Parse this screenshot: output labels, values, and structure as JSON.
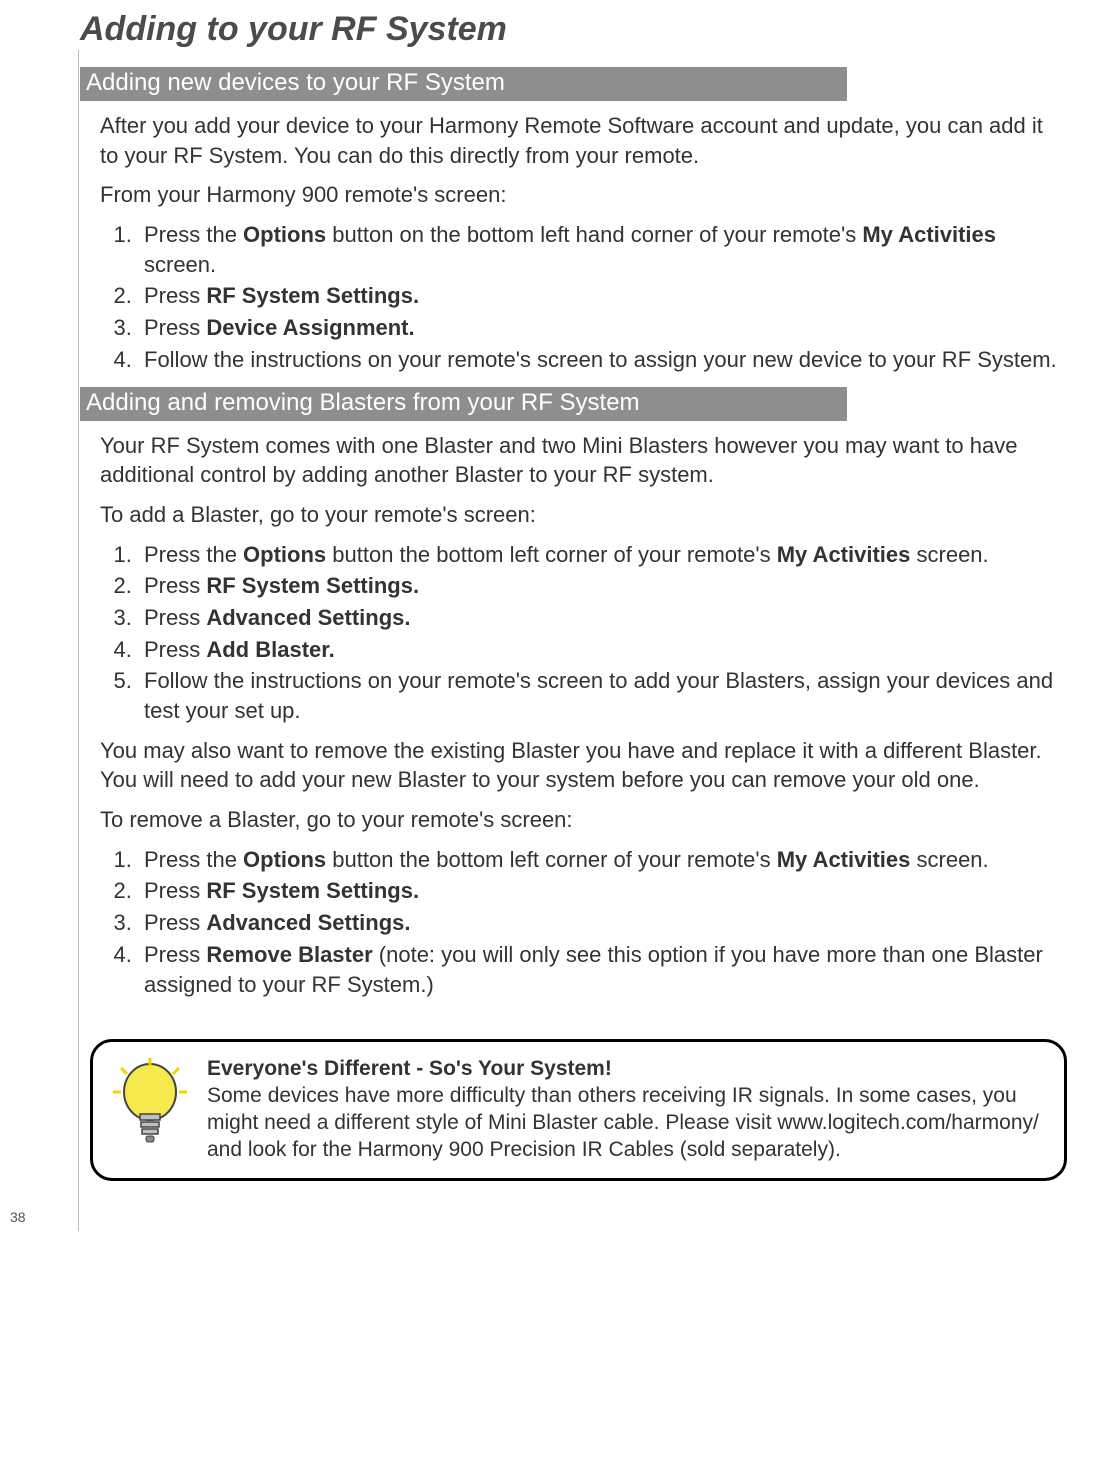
{
  "page": {
    "title": "Adding to your RF System",
    "number": "38"
  },
  "section1": {
    "heading": "Adding new devices to your RF System",
    "para1": "After you add your device to your Harmony Remote Software account and update, you can add it to your RF System. You can do this directly from your remote.",
    "para2": "From your Harmony 900 remote's screen:",
    "steps": {
      "s1a": "Press the ",
      "s1b": "Options",
      "s1c": " button on the bottom left hand corner of your remote's ",
      "s1d": "My Activities",
      "s1e": " screen.",
      "s2a": "Press ",
      "s2b": "RF System Settings.",
      "s3a": "Press ",
      "s3b": "Device Assignment.",
      "s4": "Follow the instructions on your remote's screen to assign your new device to your RF System."
    }
  },
  "section2": {
    "heading": "Adding and removing Blasters from your RF System",
    "para1": "Your RF System comes with one Blaster and two Mini Blasters however you may want to have additional control by adding another Blaster to your RF system.",
    "para2": "To add a Blaster, go to your remote's screen:",
    "stepsA": {
      "s1a": "Press the ",
      "s1b": "Options",
      "s1c": " button the bottom left corner of your remote's ",
      "s1d": "My Activities",
      "s1e": " screen.",
      "s2a": "Press ",
      "s2b": "RF System Settings.",
      "s3a": "Press ",
      "s3b": "Advanced Settings.",
      "s4a": "Press ",
      "s4b": "Add Blaster.",
      "s5": "Follow the instructions on your remote's screen to add your Blasters, assign your devices and test your set up."
    },
    "para3": "You may also want to remove the existing Blaster you have and replace it with a different Blaster. You will need to add your new Blaster to your system before you can remove your old one.",
    "para4": "To remove a Blaster, go to your remote's screen:",
    "stepsB": {
      "s1a": "Press the ",
      "s1b": "Options",
      "s1c": " button the bottom left corner of your remote's ",
      "s1d": "My Activities",
      "s1e": " screen.",
      "s2a": "Press ",
      "s2b": "RF System Settings.",
      "s3a": "Press ",
      "s3b": "Advanced Settings.",
      "s4a": "Press ",
      "s4b": "Remove Blaster",
      "s4c": " (note: you will only see this option if you have more than one Blaster assigned to your RF System.)"
    }
  },
  "tip": {
    "title": "Everyone's Different - So's Your System!",
    "body": "Some devices have more difficulty than others receiving IR signals. In some cases, you might need a different style of Mini Blaster cable. Please visit www.logitech.com/harmony/ and look for the Harmony 900 Precision IR Cables (sold separately)."
  }
}
